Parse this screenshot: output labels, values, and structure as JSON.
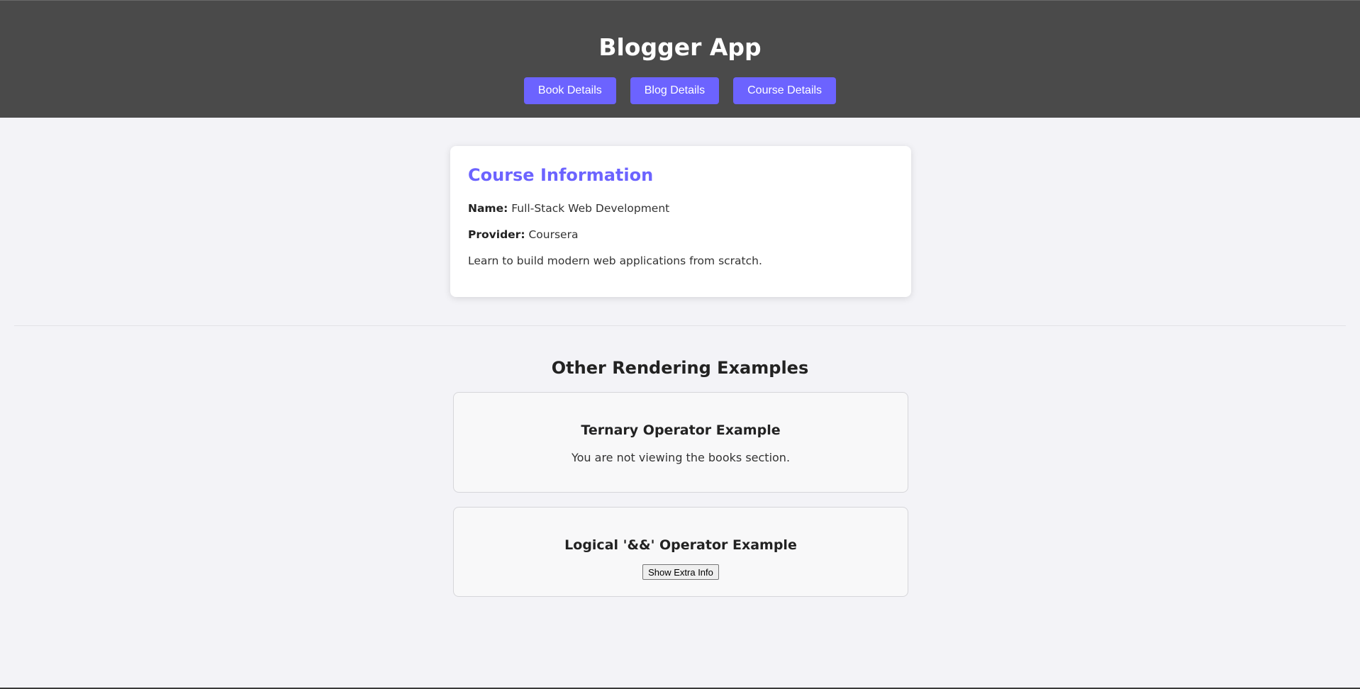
{
  "header": {
    "title": "Blogger App",
    "nav": [
      {
        "label": "Book Details"
      },
      {
        "label": "Blog Details"
      },
      {
        "label": "Course Details"
      }
    ]
  },
  "course": {
    "heading": "Course Information",
    "name_label": "Name:",
    "name_value": "Full-Stack Web Development",
    "provider_label": "Provider:",
    "provider_value": "Coursera",
    "description": "Learn to build modern web applications from scratch."
  },
  "examples": {
    "section_title": "Other Rendering Examples",
    "ternary": {
      "title": "Ternary Operator Example",
      "text": "You are not viewing the books section."
    },
    "logical": {
      "title": "Logical '&&' Operator Example",
      "button_label": "Show Extra Info"
    }
  },
  "colors": {
    "header_bg": "#4a4a4a",
    "accent": "#6c63ff",
    "page_bg": "#f3f3f7"
  }
}
